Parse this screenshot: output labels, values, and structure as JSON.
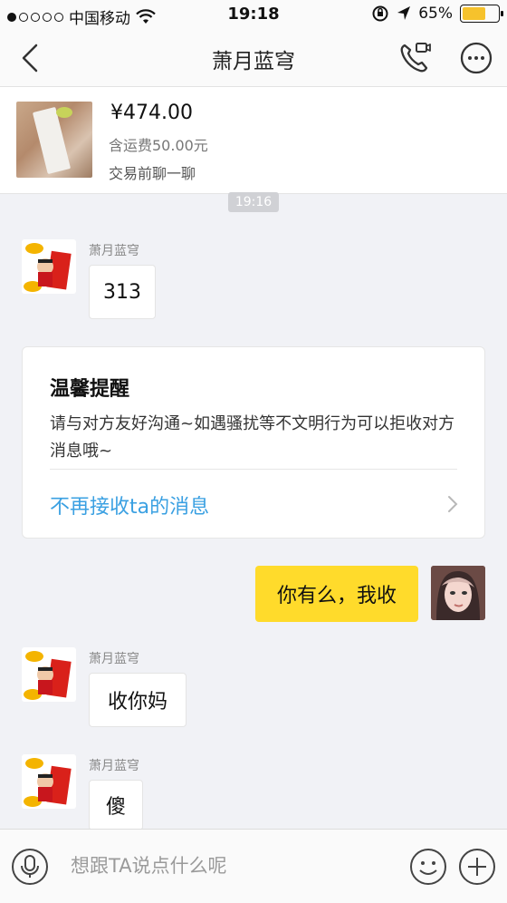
{
  "status_bar": {
    "carrier": "中国移动",
    "time": "19:18",
    "battery_percent": "65%",
    "battery_level": 0.65,
    "icons": [
      "signal-dots-icon",
      "wifi-icon",
      "rotation-lock-icon",
      "location-icon",
      "battery-icon"
    ]
  },
  "nav": {
    "title": "萧月蓝穹",
    "icons": [
      "back-chevron-icon",
      "phone-video-icon",
      "more-icon"
    ]
  },
  "product": {
    "price": "¥474.00",
    "shipping": "含运费50.00元",
    "chat_before": "交易前聊一聊"
  },
  "timestamp": "19:16",
  "messages": [
    {
      "from": "other",
      "sender": "萧月蓝穹",
      "text": "313"
    },
    {
      "from": "self",
      "text": "你有么，我收"
    },
    {
      "from": "other",
      "sender": "萧月蓝穹",
      "text": "收你妈"
    },
    {
      "from": "other",
      "sender": "萧月蓝穹",
      "text": "傻"
    }
  ],
  "reminder": {
    "title": "温馨提醒",
    "body": "请与对方友好沟通~如遇骚扰等不文明行为可以拒收对方消息哦~",
    "link": "不再接收ta的消息"
  },
  "input": {
    "placeholder": "想跟TA说点什么呢",
    "icons": [
      "microphone-icon",
      "emoji-icon",
      "plus-icon"
    ]
  },
  "colors": {
    "accent_yellow": "#ffdb2b",
    "link_blue": "#3aa0e2",
    "background": "#f1f2f6"
  }
}
